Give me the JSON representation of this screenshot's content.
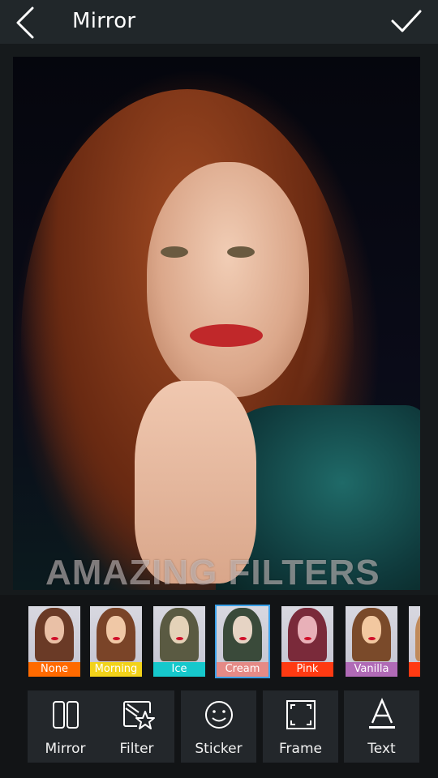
{
  "header": {
    "title": "Mirror",
    "back_icon": "chevron-left-icon",
    "confirm_icon": "checkmark-icon"
  },
  "photo": {
    "overlay_text": "AMAZING FILTERS"
  },
  "filters": {
    "selected": "Cream",
    "items": [
      {
        "label": "None",
        "color": "#ff6a00"
      },
      {
        "label": "Morning",
        "color": "#f2d21a"
      },
      {
        "label": "Ice",
        "color": "#16c8cc"
      },
      {
        "label": "Cream",
        "color": "#e58a86"
      },
      {
        "label": "Pink",
        "color": "#ff3a12"
      },
      {
        "label": "Vanilla",
        "color": "#b06ab6"
      },
      {
        "label": "",
        "color": "#ff3a12"
      }
    ]
  },
  "toolbar": {
    "items": [
      {
        "label": "Mirror",
        "icon": "mirror-icon"
      },
      {
        "label": "Filter",
        "icon": "filter-icon"
      },
      {
        "label": "Sticker",
        "icon": "smiley-icon"
      },
      {
        "label": "Frame",
        "icon": "frame-icon"
      },
      {
        "label": "Text",
        "icon": "text-icon"
      }
    ]
  }
}
